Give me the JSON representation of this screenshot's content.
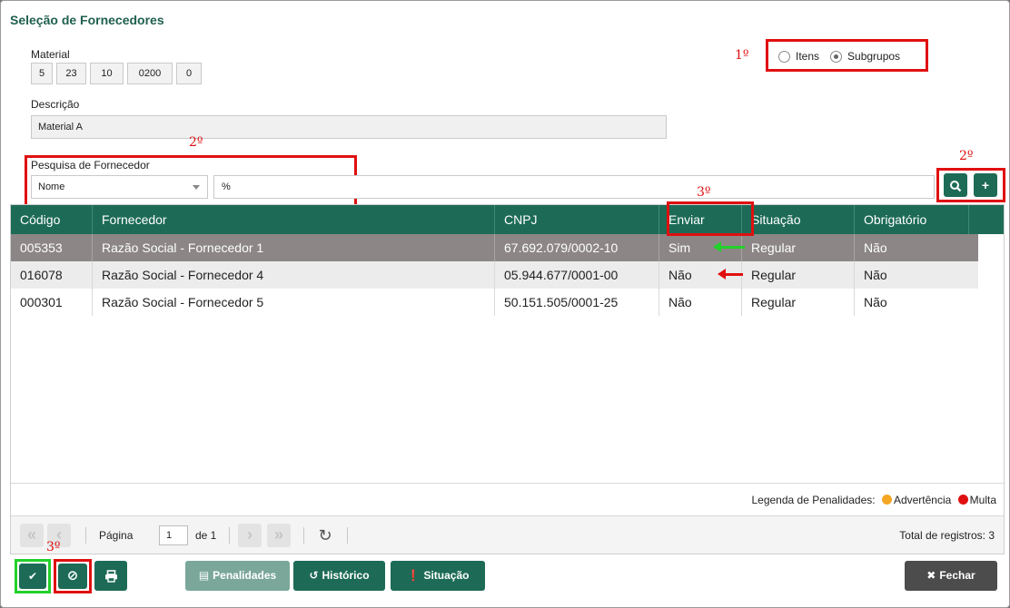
{
  "window": {
    "title": "Seleção de Fornecedores"
  },
  "material": {
    "label": "Material",
    "codes": [
      "5",
      "23",
      "10",
      "0200",
      "0"
    ]
  },
  "descricao": {
    "label": "Descrição",
    "value": "Material A"
  },
  "filter": {
    "options": {
      "itens": "Itens",
      "subgrupos": "Subgrupos"
    },
    "selected": "Subgrupos"
  },
  "pesquisa": {
    "label": "Pesquisa de Fornecedor",
    "field": "Nome",
    "term": "%"
  },
  "annotations": {
    "first": "1º",
    "second": "2º",
    "third": "3º"
  },
  "grid": {
    "columns": [
      "Código",
      "Fornecedor",
      "CNPJ",
      "Enviar",
      "Situação",
      "Obrigatório"
    ],
    "rows": [
      {
        "codigo": "005353",
        "fornecedor": "Razão Social - Fornecedor 1",
        "cnpj": "67.692.079/0002-10",
        "enviar": "Sim",
        "situacao": "Regular",
        "obrigatorio": "Não"
      },
      {
        "codigo": "016078",
        "fornecedor": "Razão Social - Fornecedor 4",
        "cnpj": "05.944.677/0001-00",
        "enviar": "Não",
        "situacao": "Regular",
        "obrigatorio": "Não"
      },
      {
        "codigo": "000301",
        "fornecedor": "Razão Social - Fornecedor 5",
        "cnpj": "50.151.505/0001-25",
        "enviar": "Não",
        "situacao": "Regular",
        "obrigatorio": "Não"
      }
    ]
  },
  "legend": {
    "label": "Legenda de Penalidades:",
    "advertencia": "Advertência",
    "multa": "Multa",
    "colors": {
      "advertencia": "#f5a623",
      "multa": "#e01010"
    }
  },
  "pager": {
    "page_label": "Página",
    "page": "1",
    "of_label": "de 1",
    "total": "Total de registros: 3"
  },
  "buttons": {
    "penalidades": "Penalidades",
    "historico": "Histórico",
    "situacao": "Situação",
    "fechar": "Fechar"
  },
  "colors": {
    "accent": "#1d6b56",
    "annotation_red": "#e01010",
    "annotation_green": "#23d12b"
  }
}
